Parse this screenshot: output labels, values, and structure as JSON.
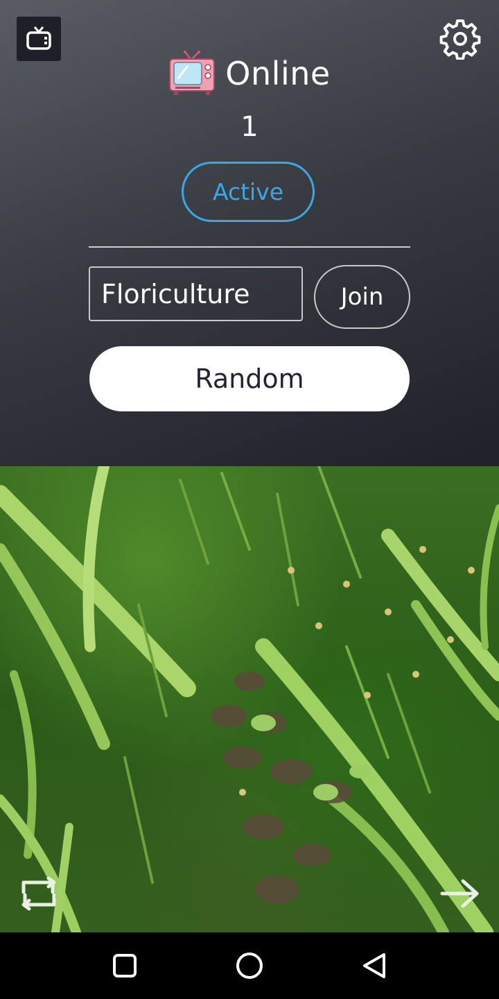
{
  "header": {
    "title": "Online",
    "online_count": "1",
    "status_button": "Active"
  },
  "room": {
    "input_value": "Floriculture",
    "join_label": "Join",
    "random_label": "Random"
  },
  "colors": {
    "accent": "#3aa8e6",
    "panel_top": "#5a5c63",
    "panel_bottom": "#1f2028"
  },
  "icons": {
    "tv_button": "tv-icon",
    "settings": "gear-icon",
    "title_emoji": "television-emoji",
    "switch_camera": "rotate-camera-icon",
    "next": "arrow-right-icon",
    "nav_recents": "square-icon",
    "nav_home": "circle-icon",
    "nav_back": "triangle-back-icon"
  }
}
